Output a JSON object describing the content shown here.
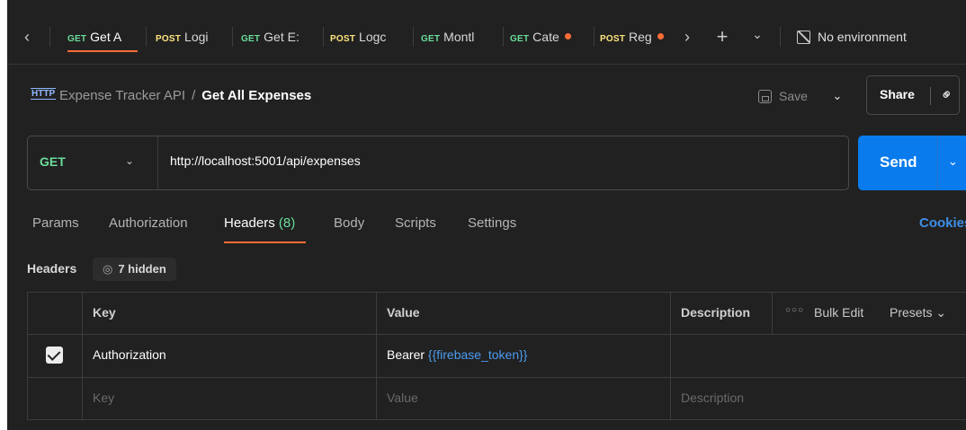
{
  "tabs": [
    {
      "method": "GET",
      "title": "Get A"
    },
    {
      "method": "POST",
      "title": "Logi"
    },
    {
      "method": "GET",
      "title": "Get E:"
    },
    {
      "method": "POST",
      "title": "Logc"
    },
    {
      "method": "GET",
      "title": "Montl"
    },
    {
      "method": "GET",
      "title": "Cate"
    },
    {
      "method": "POST",
      "title": "Reg"
    }
  ],
  "tabbar": {
    "nav_left": "‹",
    "nav_right": "›",
    "new_tab": "+",
    "more": "⌄",
    "environment": "No environment"
  },
  "breadcrumb": {
    "icon": "HTTP",
    "collection": "Expense Tracker API",
    "separator": "/",
    "request": "Get All Expenses"
  },
  "actions": {
    "save": "Save",
    "share": "Share"
  },
  "request": {
    "method": "GET",
    "url": "http://localhost:5001/api/expenses",
    "send": "Send"
  },
  "request_tabs": {
    "params": "Params",
    "authorization": "Authorization",
    "headers": "Headers",
    "headers_count": "(8)",
    "body": "Body",
    "scripts": "Scripts",
    "settings": "Settings",
    "cookies": "Cookies"
  },
  "headers_section": {
    "label": "Headers",
    "hidden": "7 hidden"
  },
  "table": {
    "columns": {
      "key": "Key",
      "value": "Value",
      "description": "Description"
    },
    "bulk_edit": "Bulk Edit",
    "presets": "Presets",
    "rows": [
      {
        "checked": true,
        "key": "Authorization",
        "value_prefix": "Bearer",
        "value_var": "{{firebase_token}}",
        "description": ""
      }
    ],
    "placeholders": {
      "key": "Key",
      "value": "Value",
      "description": "Description"
    }
  },
  "colors": {
    "get": "#6bdd9a",
    "post": "#ffe47e",
    "accent": "#ff6c37",
    "send": "#097bed",
    "variable": "#4c9cf0"
  }
}
